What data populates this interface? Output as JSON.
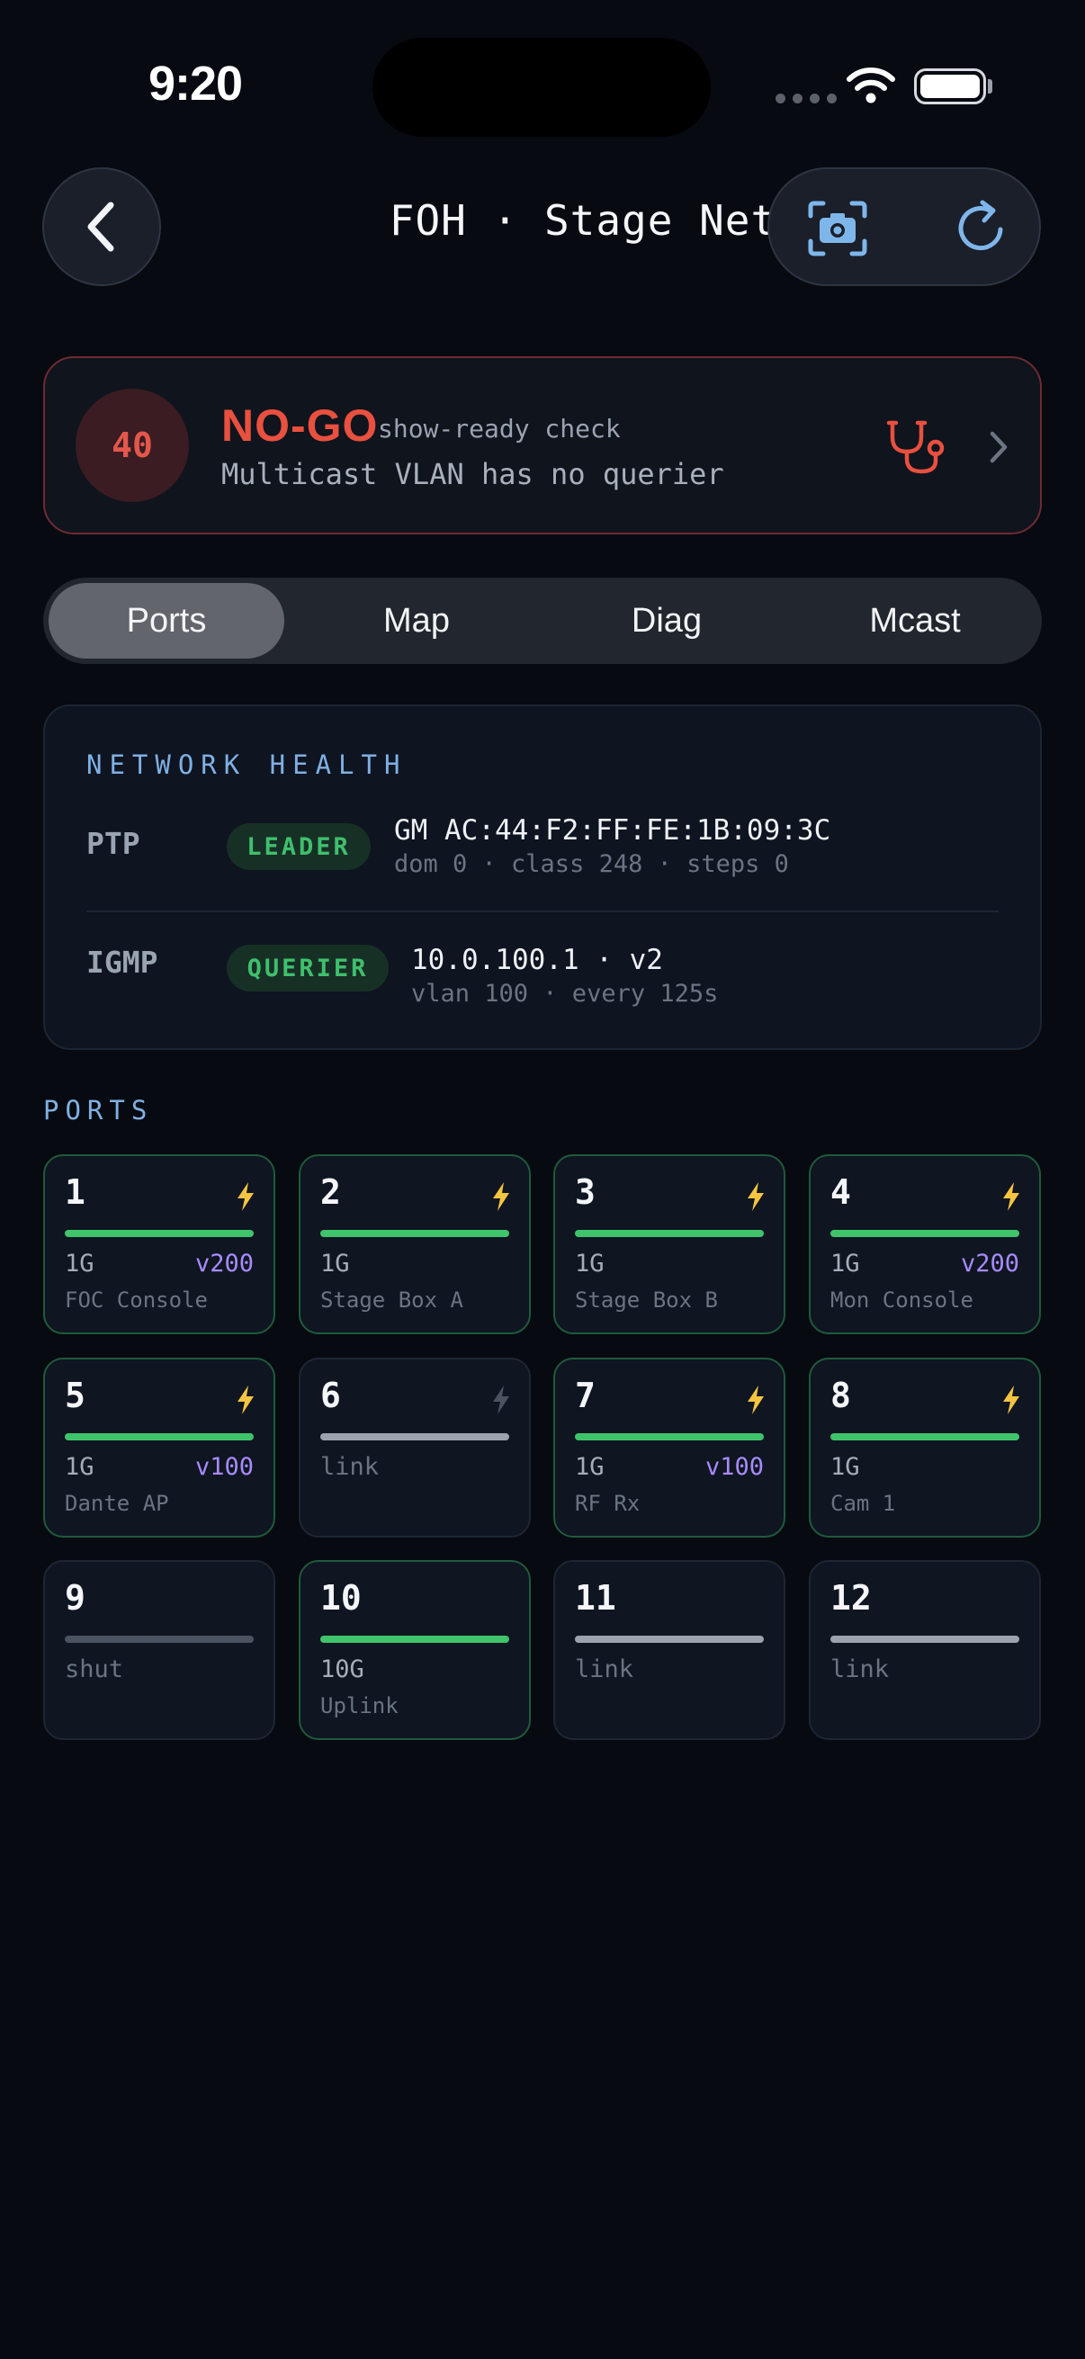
{
  "status_bar": {
    "time": "9:20"
  },
  "header": {
    "title": "FOH · Stage Net"
  },
  "banner": {
    "score": "40",
    "verdict": "NO-GO",
    "subtitle": "show-ready check",
    "message": "Multicast VLAN has no querier"
  },
  "tabs": [
    {
      "label": "Ports",
      "active": true
    },
    {
      "label": "Map",
      "active": false
    },
    {
      "label": "Diag",
      "active": false
    },
    {
      "label": "Mcast",
      "active": false
    }
  ],
  "health": {
    "title": "NETWORK HEALTH",
    "ptp": {
      "label": "PTP",
      "badge": "LEADER",
      "main": "GM AC:44:F2:FF:FE:1B:09:3C",
      "sub": "dom 0 · class 248 · steps 0"
    },
    "igmp": {
      "label": "IGMP",
      "badge": "QUERIER",
      "main": "10.0.100.1 · v2",
      "sub": "vlan 100 · every 125s"
    }
  },
  "ports_title": "PORTS",
  "ports": [
    {
      "num": "1",
      "speed": "1G",
      "vlan": "v200",
      "name": "FOC Console",
      "state": "up"
    },
    {
      "num": "2",
      "speed": "1G",
      "vlan": "",
      "name": "Stage Box A",
      "state": "up"
    },
    {
      "num": "3",
      "speed": "1G",
      "vlan": "",
      "name": "Stage Box B",
      "state": "up"
    },
    {
      "num": "4",
      "speed": "1G",
      "vlan": "v200",
      "name": "Mon Console",
      "state": "up"
    },
    {
      "num": "5",
      "speed": "1G",
      "vlan": "v100",
      "name": "Dante AP",
      "state": "up"
    },
    {
      "num": "6",
      "speed": "",
      "vlan": "",
      "name": "",
      "status": "link",
      "state": "link"
    },
    {
      "num": "7",
      "speed": "1G",
      "vlan": "v100",
      "name": "RF Rx",
      "state": "up"
    },
    {
      "num": "8",
      "speed": "1G",
      "vlan": "",
      "name": "Cam 1",
      "state": "up"
    },
    {
      "num": "9",
      "speed": "",
      "vlan": "",
      "name": "",
      "status": "shut",
      "state": "shut"
    },
    {
      "num": "10",
      "speed": "10G",
      "vlan": "",
      "name": "Uplink",
      "state": "up-nopoe"
    },
    {
      "num": "11",
      "speed": "",
      "vlan": "",
      "name": "",
      "status": "link",
      "state": "link-nopoe"
    },
    {
      "num": "12",
      "speed": "",
      "vlan": "",
      "name": "",
      "status": "link",
      "state": "link-nopoe"
    }
  ],
  "colors": {
    "up": "#3fc46c",
    "link": "#9ca3af",
    "shut": "#4b5260",
    "poe": "#f5c542",
    "poe_off": "#4b5260",
    "vlan": "#a78bfa"
  }
}
